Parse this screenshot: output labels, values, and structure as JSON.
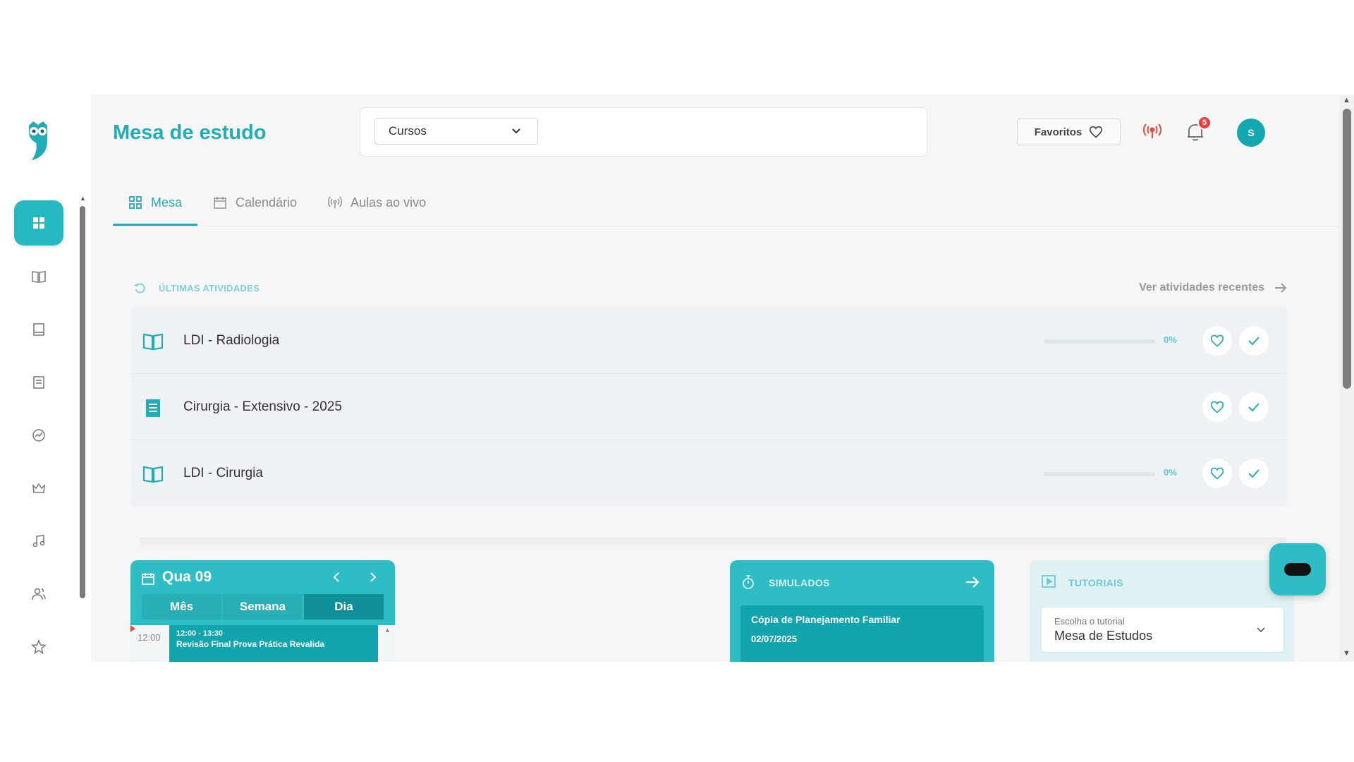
{
  "header": {
    "title": "Mesa de estudo",
    "course_select": "Cursos",
    "favorites_label": "Favoritos",
    "notification_count": "5",
    "avatar_initial": "S"
  },
  "tabs": [
    {
      "label": "Mesa",
      "icon": "grid-icon",
      "active": true
    },
    {
      "label": "Calendário",
      "icon": "calendar-icon",
      "active": false
    },
    {
      "label": "Aulas ao vivo",
      "icon": "broadcast-icon",
      "active": false
    }
  ],
  "sidebar": {
    "items": [
      {
        "icon": "dashboard-icon",
        "active": true
      },
      {
        "icon": "book-open-icon"
      },
      {
        "icon": "book-icon"
      },
      {
        "icon": "notebook-icon"
      },
      {
        "icon": "chart-icon"
      },
      {
        "icon": "crown-icon"
      },
      {
        "icon": "music-icon"
      },
      {
        "icon": "users-icon"
      },
      {
        "icon": "star-icon"
      }
    ]
  },
  "recent": {
    "title": "ÚLTIMAS ATIVIDADES",
    "link": "Ver atividades recentes",
    "items": [
      {
        "name": "LDI - Radiologia",
        "icon": "book-open-icon",
        "progress": "0%",
        "progress_value": 0
      },
      {
        "name": "Cirurgia - Extensivo - 2025",
        "icon": "notebook-icon",
        "progress": null,
        "progress_value": null
      },
      {
        "name": "LDI - Cirurgia",
        "icon": "book-open-icon",
        "progress": "0%",
        "progress_value": 0
      }
    ]
  },
  "calendar": {
    "title": "Qua 09",
    "views": [
      "Mês",
      "Semana",
      "Dia"
    ],
    "active_view": "Dia",
    "time_label": "12:00",
    "event_time": "12:00 - 13:30",
    "event_title": "Revisão Final Prova Prática Revalida"
  },
  "simulados": {
    "title": "SIMULADOS",
    "card_name": "Cópia de Planejamento Familiar",
    "card_date": "02/07/2025"
  },
  "tutoriais": {
    "title": "TUTORIAIS",
    "select_label": "Escolha o tutorial",
    "select_value": "Mesa de Estudos"
  },
  "colors": {
    "accent": "#21adb6",
    "accent_dark": "#12a5ae",
    "badge": "#ef3b3b",
    "live_icon": "#e74c3c"
  }
}
